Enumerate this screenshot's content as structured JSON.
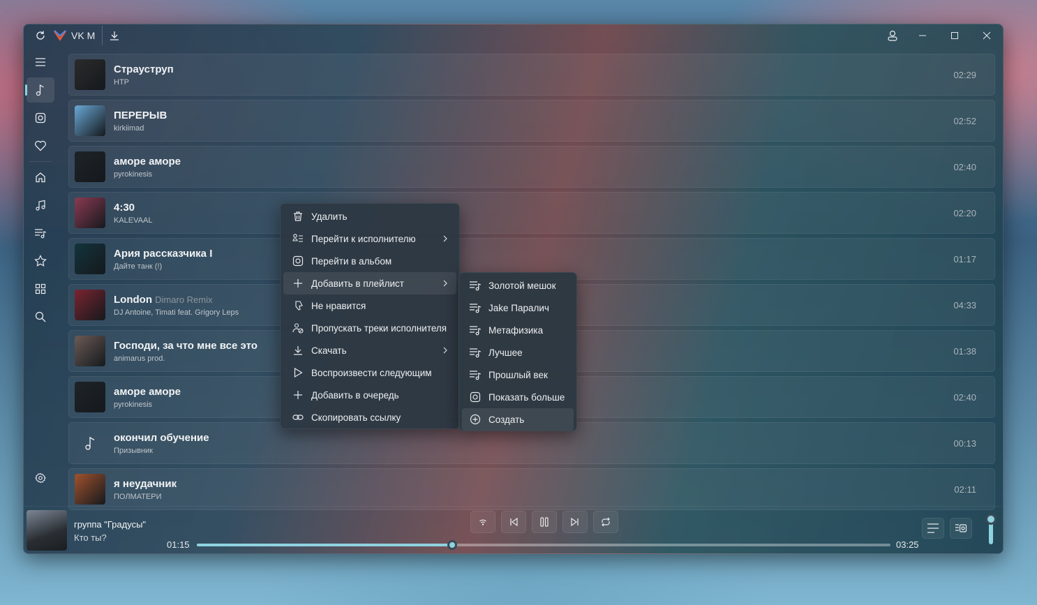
{
  "window": {
    "title": "VK M"
  },
  "sidebar": {
    "items": [
      {
        "icon": "menu-icon"
      },
      {
        "icon": "music-note-icon",
        "active": true
      },
      {
        "icon": "album-icon"
      },
      {
        "icon": "heart-icon"
      },
      {
        "icon": "home-icon"
      },
      {
        "icon": "music-library-icon"
      },
      {
        "icon": "playlist-icon"
      },
      {
        "icon": "star-icon"
      },
      {
        "icon": "grid-icon"
      },
      {
        "icon": "search-icon"
      },
      {
        "icon": "settings-icon"
      }
    ]
  },
  "tracks": [
    {
      "title": "Страуструп",
      "remix": "",
      "artist": "HTP",
      "duration": "02:29",
      "cover": "#2b2b2b"
    },
    {
      "title": "ПЕРЕРЫВ",
      "remix": "",
      "artist": "kirkiimad",
      "duration": "02:52",
      "cover": "#6aa8d6"
    },
    {
      "title": "аморе аморе",
      "remix": "",
      "artist": "pyrokinesis",
      "duration": "02:40",
      "cover": "#1e2328"
    },
    {
      "title": "4:30",
      "remix": "",
      "artist": "KALEVAAL",
      "duration": "02:20",
      "cover": "#8b3a52"
    },
    {
      "title": "Ария рассказчика I",
      "remix": "",
      "artist": "Дайте танк (!)",
      "duration": "01:17",
      "cover": "#12343c"
    },
    {
      "title": "London",
      "remix": "Dimaro Remix",
      "artist": "DJ Antoine, Timati feat. Grigory Leps",
      "duration": "04:33",
      "cover": "#7a2430"
    },
    {
      "title": "Господи, за что мне все это",
      "remix": "",
      "artist": "animarus prod.",
      "duration": "01:38",
      "cover": "#6b5a55"
    },
    {
      "title": "аморе аморе",
      "remix": "",
      "artist": "pyrokinesis",
      "duration": "02:40",
      "cover": "#1e2328"
    },
    {
      "title": "окончил обучение",
      "remix": "",
      "artist": "Призывник",
      "duration": "00:13",
      "cover": ""
    },
    {
      "title": "я неудачник",
      "remix": "",
      "artist": "ПОЛМАТЕРИ",
      "duration": "02:11",
      "cover": "#a0522d"
    }
  ],
  "context_menu": {
    "items": [
      {
        "label": "Удалить",
        "icon": "trash-icon",
        "submenu": false
      },
      {
        "label": "Перейти к исполнителю",
        "icon": "artist-list-icon",
        "submenu": true
      },
      {
        "label": "Перейти в альбом",
        "icon": "album-icon",
        "submenu": false
      },
      {
        "label": "Добавить в плейлист",
        "icon": "plus-icon",
        "submenu": true,
        "highlighted": true
      },
      {
        "label": "Не нравится",
        "icon": "dislike-icon",
        "submenu": false
      },
      {
        "label": "Пропускать треки исполнителя",
        "icon": "block-artist-icon",
        "submenu": false
      },
      {
        "label": "Скачать",
        "icon": "download-icon",
        "submenu": true
      },
      {
        "label": "Воспроизвести следующим",
        "icon": "play-next-icon",
        "submenu": false
      },
      {
        "label": "Добавить в очередь",
        "icon": "plus-icon",
        "submenu": false
      },
      {
        "label": "Скопировать ссылку",
        "icon": "link-icon",
        "submenu": false
      }
    ]
  },
  "playlist_submenu": {
    "items": [
      {
        "label": "Золотой мешок",
        "icon": "playlist-icon"
      },
      {
        "label": "Jake Паралич",
        "icon": "playlist-icon"
      },
      {
        "label": "Метафизика",
        "icon": "playlist-icon"
      },
      {
        "label": "Лучшее",
        "icon": "playlist-icon"
      },
      {
        "label": "Прошлый век",
        "icon": "playlist-icon"
      },
      {
        "label": "Показать больше",
        "icon": "album-icon"
      },
      {
        "label": "Создать",
        "icon": "plus-circle-icon",
        "highlighted": true
      }
    ]
  },
  "player": {
    "title": "группа \"Градусы\"",
    "artist": "Кто ты?",
    "elapsed": "01:15",
    "total": "03:25",
    "progress": 0.368,
    "volume": 1.0,
    "accent": "#8fd2e0"
  }
}
